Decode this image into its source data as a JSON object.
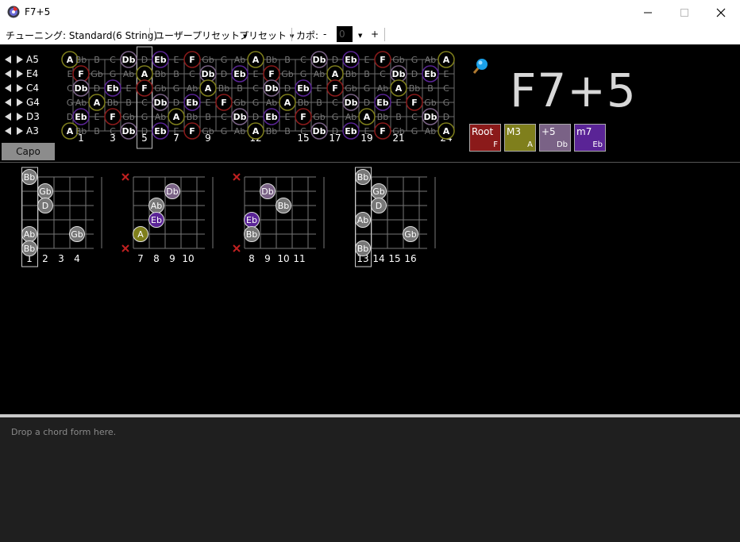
{
  "window": {
    "title": "F7+5"
  },
  "toolbar": {
    "tuning": "チューニング: Standard(6 String)",
    "user_preset": "ユーザープリセット",
    "preset": "プリセット",
    "capo_label": "カポ:",
    "minus": "-",
    "capo_value": "0",
    "plus": "+"
  },
  "strings": [
    "A5",
    "E4",
    "C4",
    "G4",
    "D3",
    "A3"
  ],
  "fret_numbers": [
    "1",
    "3",
    "5",
    "7",
    "9",
    "12",
    "15",
    "17",
    "19",
    "21",
    "24"
  ],
  "capo_button": "Capo",
  "chord_name": "F7+5",
  "intervals": [
    {
      "name": "Root",
      "note": "F",
      "color": "#8b1a1a"
    },
    {
      "name": "M3",
      "note": "A",
      "color": "#7f7f1c"
    },
    {
      "name": "+5",
      "note": "Db",
      "color": "#7a6286"
    },
    {
      "name": "m7",
      "note": "Eb",
      "color": "#5a2496"
    }
  ],
  "other_note_color": "#777777",
  "forms": [
    {
      "fret_labels": [
        "1",
        "2",
        "3",
        "4"
      ]
    },
    {
      "fret_labels": [
        "7",
        "8",
        "9",
        "10"
      ]
    },
    {
      "fret_labels": [
        "8",
        "9",
        "10",
        "11"
      ]
    },
    {
      "fret_labels": [
        "13",
        "14",
        "15",
        "16"
      ]
    }
  ],
  "drop_area": {
    "text": "Drop a chord form here."
  },
  "tuning_midi": [
    81,
    64,
    60,
    55,
    50,
    45
  ]
}
